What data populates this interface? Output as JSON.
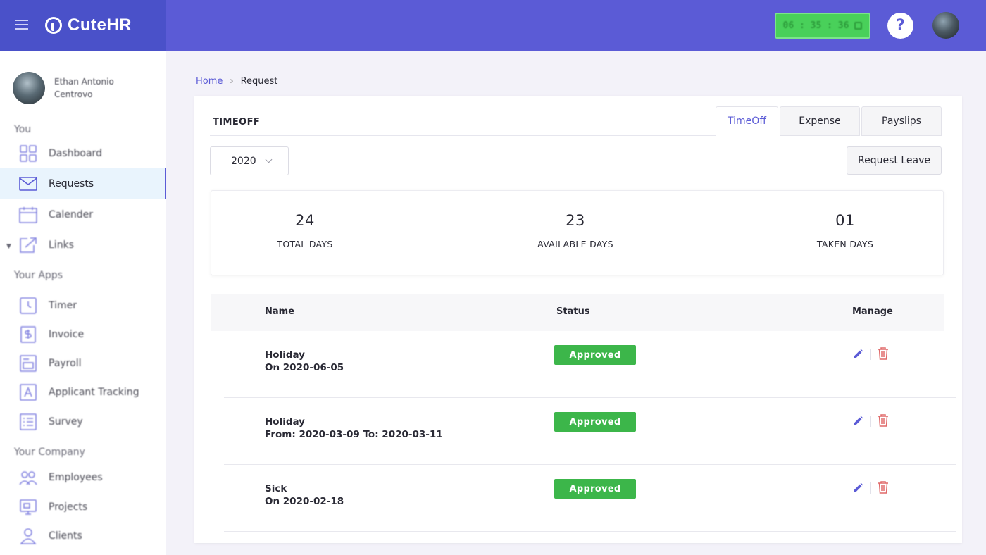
{
  "app": {
    "brand": "CuteHR",
    "timer": "06 : 35 : 36",
    "help_label": "?"
  },
  "user": {
    "name_line1": "Ethan Antonio",
    "name_line2": "Centrovo"
  },
  "sidebar": {
    "sections": [
      {
        "label": "You"
      },
      {
        "label": "Your Apps"
      },
      {
        "label": "Your Company"
      }
    ],
    "items": [
      {
        "label": "Dashboard",
        "icon": "dashboard-icon"
      },
      {
        "label": "Requests",
        "icon": "mail-icon",
        "active": true
      },
      {
        "label": "Calender",
        "icon": "calendar-icon"
      },
      {
        "label": "Links",
        "icon": "link-icon"
      },
      {
        "label": "Timer",
        "icon": "timer-icon"
      },
      {
        "label": "Invoice",
        "icon": "invoice-icon"
      },
      {
        "label": "Payroll",
        "icon": "payroll-icon"
      },
      {
        "label": "Applicant Tracking",
        "icon": "applicant-icon"
      },
      {
        "label": "Survey",
        "icon": "survey-icon"
      },
      {
        "label": "Employees",
        "icon": "employees-icon"
      },
      {
        "label": "Projects",
        "icon": "projects-icon"
      },
      {
        "label": "Clients",
        "icon": "clients-icon"
      }
    ]
  },
  "breadcrumb": {
    "home": "Home",
    "separator": "›",
    "current": "Request"
  },
  "panel": {
    "title": "TIMEOFF",
    "tabs": [
      {
        "label": "TimeOff",
        "active": true
      },
      {
        "label": "Expense"
      },
      {
        "label": "Payslips"
      }
    ],
    "year": "2020",
    "request_button": "Request Leave"
  },
  "stats": [
    {
      "value": "24",
      "label": "TOTAL DAYS"
    },
    {
      "value": "23",
      "label": "AVAILABLE DAYS"
    },
    {
      "value": "01",
      "label": "TAKEN DAYS"
    }
  ],
  "table": {
    "headers": {
      "name": "Name",
      "status": "Status",
      "manage": "Manage"
    },
    "rows": [
      {
        "type": "Holiday",
        "dates": "On 2020-06-05",
        "status": "Approved"
      },
      {
        "type": "Holiday",
        "dates": "From: 2020-03-09 To: 2020-03-11",
        "status": "Approved"
      },
      {
        "type": "Sick",
        "dates": "On 2020-02-18",
        "status": "Approved"
      }
    ]
  },
  "colors": {
    "topbar": "#5b5bd6",
    "brand_bg": "#4a51c9",
    "accent": "#5b5bd6",
    "approved": "#3cb64a",
    "delete": "#e06a6a",
    "active_nav_bg": "#e9f4fd"
  }
}
